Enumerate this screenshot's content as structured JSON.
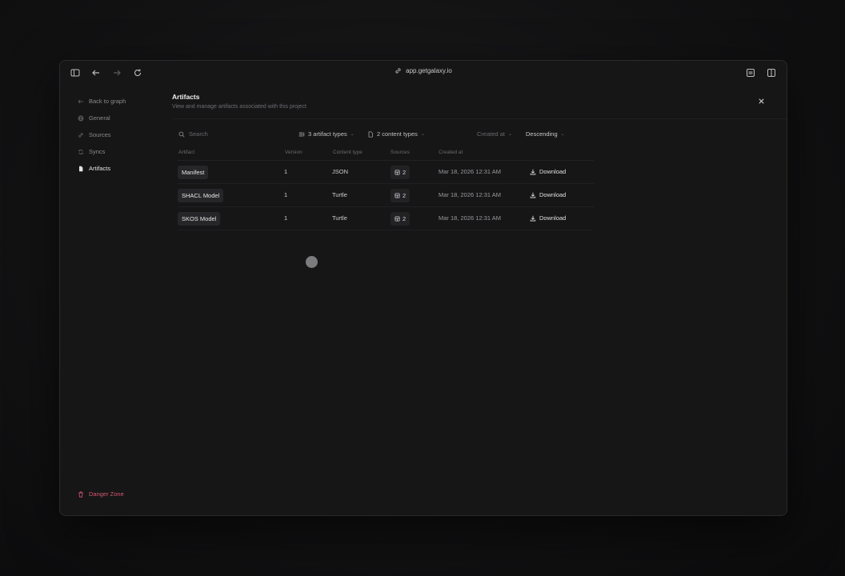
{
  "browser": {
    "url": "app.getgalaxy.io"
  },
  "sidebar": {
    "items": [
      {
        "label": "Back to graph",
        "icon": "arrow-left-icon"
      },
      {
        "label": "General",
        "icon": "globe-icon"
      },
      {
        "label": "Sources",
        "icon": "link-icon"
      },
      {
        "label": "Syncs",
        "icon": "sync-icon"
      },
      {
        "label": "Artifacts",
        "icon": "file-icon",
        "active": true
      }
    ],
    "danger_zone": "Danger Zone"
  },
  "header": {
    "title": "Artifacts",
    "subtitle": "View and manage artifacts associated with this project"
  },
  "filters": {
    "search_placeholder": "Search",
    "artifact_types": "3 artifact types",
    "content_types": "2 content types",
    "sort_field": "Created at",
    "sort_order": "Descending"
  },
  "table": {
    "columns": [
      "Artifact",
      "Version",
      "Content type",
      "Sources",
      "Created at"
    ],
    "rows": [
      {
        "artifact": "Manifest",
        "version": "1",
        "content_type": "JSON",
        "sources": "2",
        "created_at": "Mar 18, 2026 12:31 AM",
        "action": "Download"
      },
      {
        "artifact": "SHACL Model",
        "version": "1",
        "content_type": "Turtle",
        "sources": "2",
        "created_at": "Mar 18, 2026 12:31 AM",
        "action": "Download"
      },
      {
        "artifact": "SKOS Model",
        "version": "1",
        "content_type": "Turtle",
        "sources": "2",
        "created_at": "Mar 18, 2026 12:31 AM",
        "action": "Download"
      }
    ]
  },
  "colors": {
    "danger": "#d4566e",
    "window_bg": "#161617"
  }
}
